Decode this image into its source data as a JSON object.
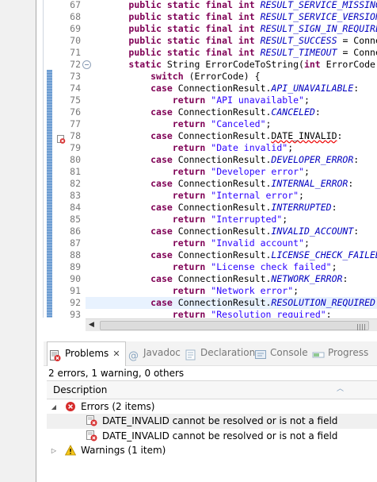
{
  "editor": {
    "lines": [
      {
        "n": "67",
        "html": "        <span class=\"kw\">public static final int</span> <span class=\"fld\">RESULT_SERVICE_MISSING</span> ="
      },
      {
        "n": "68",
        "html": "        <span class=\"kw\">public static final int</span> <span class=\"fld\">RESULT_SERVICE_VERSION_UP</span>"
      },
      {
        "n": "69",
        "html": "        <span class=\"kw\">public static final int</span> <span class=\"fld\">RESULT_SIGN_IN_REQUIRED</span> ="
      },
      {
        "n": "70",
        "html": "        <span class=\"kw\">public static final int</span> <span class=\"fld\">RESULT_SUCCESS</span> = Connecti"
      },
      {
        "n": "71",
        "html": "        <span class=\"kw\">public static final int</span> <span class=\"fld\">RESULT_TIMEOUT</span> = Connecti"
      },
      {
        "n": "72",
        "html": "        <span class=\"kw\">static</span> String ErrorCodeToString(<span class=\"kw\">int</span> ErrorCode) {"
      },
      {
        "n": "73",
        "html": "            <span class=\"kw\">switch</span> (ErrorCode) {"
      },
      {
        "n": "74",
        "html": "            <span class=\"kw\">case</span> ConnectionResult.<span class=\"fld\">API_UNAVAILABLE</span>:"
      },
      {
        "n": "75",
        "html": "                <span class=\"kw\">return</span> <span class=\"str\">\"API unavailable\"</span>;"
      },
      {
        "n": "76",
        "html": "            <span class=\"kw\">case</span> ConnectionResult.<span class=\"fld\">CANCELED</span>:"
      },
      {
        "n": "77",
        "html": "                <span class=\"kw\">return</span> <span class=\"str\">\"Canceled\"</span>;"
      },
      {
        "n": "78",
        "html": "            <span class=\"kw\">case</span> ConnectionResult.<span class=\"err\">DATE_INVALID</span>:"
      },
      {
        "n": "79",
        "html": "                <span class=\"kw\">return</span> <span class=\"str\">\"Date invalid\"</span>;"
      },
      {
        "n": "80",
        "html": "            <span class=\"kw\">case</span> ConnectionResult.<span class=\"fld\">DEVELOPER_ERROR</span>:"
      },
      {
        "n": "81",
        "html": "                <span class=\"kw\">return</span> <span class=\"str\">\"Developer error\"</span>;"
      },
      {
        "n": "82",
        "html": "            <span class=\"kw\">case</span> ConnectionResult.<span class=\"fld\">INTERNAL_ERROR</span>:"
      },
      {
        "n": "83",
        "html": "                <span class=\"kw\">return</span> <span class=\"str\">\"Internal error\"</span>;"
      },
      {
        "n": "84",
        "html": "            <span class=\"kw\">case</span> ConnectionResult.<span class=\"fld\">INTERRUPTED</span>:"
      },
      {
        "n": "85",
        "html": "                <span class=\"kw\">return</span> <span class=\"str\">\"Interrupted\"</span>;"
      },
      {
        "n": "86",
        "html": "            <span class=\"kw\">case</span> ConnectionResult.<span class=\"fld\">INVALID_ACCOUNT</span>:"
      },
      {
        "n": "87",
        "html": "                <span class=\"kw\">return</span> <span class=\"str\">\"Invalid account\"</span>;"
      },
      {
        "n": "88",
        "html": "            <span class=\"kw\">case</span> ConnectionResult.<span class=\"fld\">LICENSE_CHECK_FAILED</span>:"
      },
      {
        "n": "89",
        "html": "                <span class=\"kw\">return</span> <span class=\"str\">\"License check failed\"</span>;"
      },
      {
        "n": "90",
        "html": "            <span class=\"kw\">case</span> ConnectionResult.<span class=\"fld\">NETWORK_ERROR</span>:"
      },
      {
        "n": "91",
        "html": "                <span class=\"kw\">return</span> <span class=\"str\">\"Network error\"</span>;"
      },
      {
        "n": "92",
        "html": "            <span class=\"kw\">case</span> ConnectionResult.<span class=\"fld\">RESOLUTION_REQUIRED</span>:"
      },
      {
        "n": "93",
        "html": "                <span class=\"kw\">return</span> <span class=\"str\">\"Resolution required\"</span>;"
      }
    ],
    "highlighted_line": "92",
    "error_line": "78",
    "fold_line": "72",
    "fold_symbol": "⊖"
  },
  "tabs": [
    {
      "id": "problems",
      "label": "Problems",
      "icon": "problems-icon",
      "active": true,
      "close": "✕"
    },
    {
      "id": "javadoc",
      "label": "Javadoc",
      "icon": "javadoc-icon",
      "active": false
    },
    {
      "id": "declaration",
      "label": "Declaration",
      "icon": "declaration-icon",
      "active": false
    },
    {
      "id": "console",
      "label": "Console",
      "icon": "console-icon",
      "active": false
    },
    {
      "id": "progress",
      "label": "Progress",
      "icon": "progress-icon",
      "active": false
    }
  ],
  "problems": {
    "summary": "2 errors, 1 warning, 0 others",
    "column_description": "Description",
    "rows": [
      {
        "level": 0,
        "twist": "◢",
        "icon": "error-group-icon",
        "label": "Errors (2 items)",
        "selected": false
      },
      {
        "level": 1,
        "twist": "",
        "icon": "error-marker-icon",
        "label": "DATE_INVALID cannot be resolved or is not a field",
        "selected": true
      },
      {
        "level": 1,
        "twist": "",
        "icon": "error-marker-icon",
        "label": "DATE_INVALID cannot be resolved or is not a field",
        "selected": false
      },
      {
        "level": 0,
        "twist": "▷",
        "icon": "warning-icon",
        "label": "Warnings (1 item)",
        "selected": false
      }
    ]
  },
  "colors": {
    "keyword": "#7f0055",
    "field": "#0000c0",
    "string": "#2a00ff",
    "error": "#e00000",
    "highlight": "#e8f2fe"
  }
}
